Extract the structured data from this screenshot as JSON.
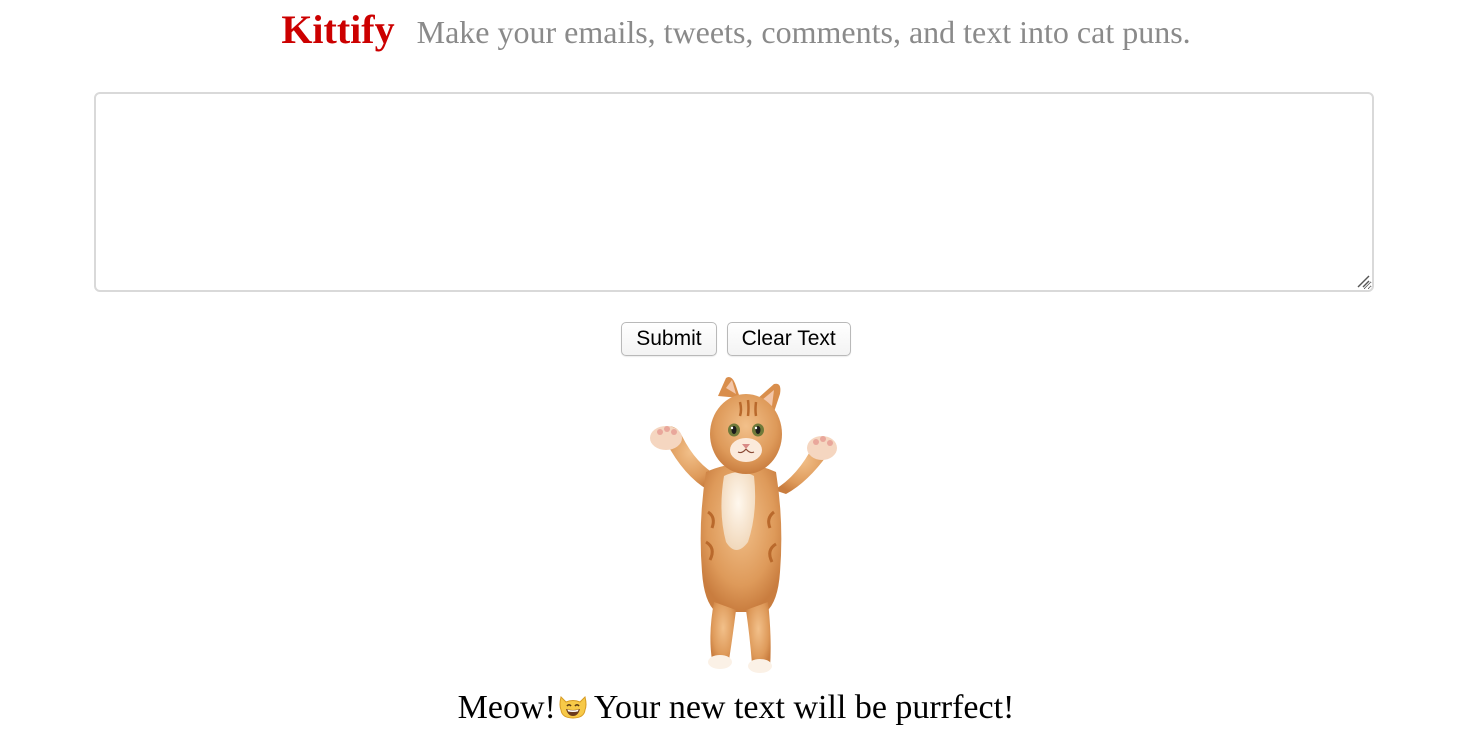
{
  "header": {
    "brand": "Kittify",
    "tagline": "Make your emails, tweets, comments, and text into cat puns."
  },
  "input": {
    "value": "",
    "placeholder": ""
  },
  "buttons": {
    "submit_label": "Submit",
    "clear_label": "Clear Text"
  },
  "footer": {
    "lead": "Meow!",
    "emoji_icon": "grinning-cat-emoji-icon",
    "message": "Your new text will be purrfect!"
  },
  "image": {
    "subject": "kitten-photo"
  },
  "colors": {
    "brand": "#cc0000",
    "tagline": "#8a8a8a",
    "text": "#000000",
    "background": "#ffffff",
    "border": "#d9d9d9"
  }
}
